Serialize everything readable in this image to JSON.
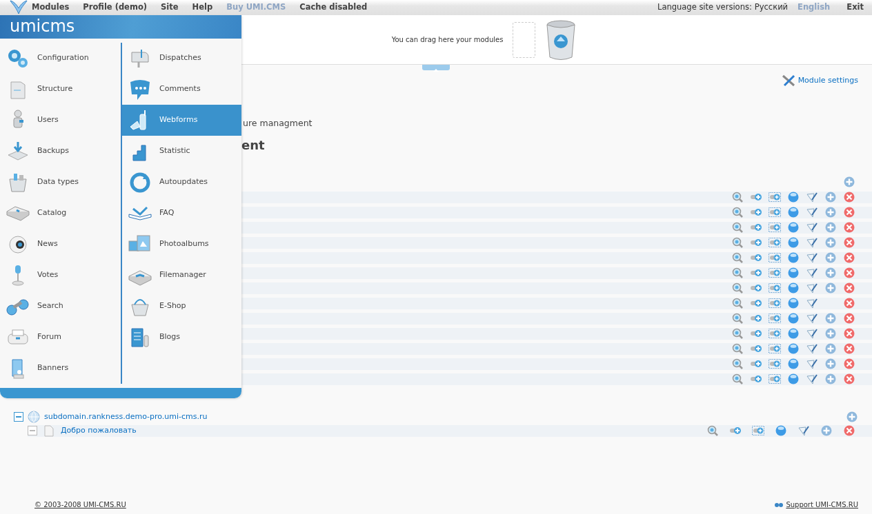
{
  "top_menu": [
    {
      "label": "Modules",
      "kind": "menu"
    },
    {
      "label": "Profile (demo)",
      "kind": "menu"
    },
    {
      "label": "Site",
      "kind": "menu"
    },
    {
      "label": "Help",
      "kind": "menu"
    },
    {
      "label": "Buy UMI.CMS",
      "kind": "promo"
    },
    {
      "label": "Cache disabled",
      "kind": "menu"
    }
  ],
  "languages": {
    "label": "Language site versions:",
    "items": [
      {
        "label": "Русский",
        "selected": true
      },
      {
        "label": "English",
        "selected": false
      }
    ]
  },
  "exit": "Exit",
  "dropzone": {
    "text": "You can drag here your modules"
  },
  "module_settings": "Module settings",
  "page": {
    "subtitle": "ure managment",
    "heading": "ent"
  },
  "rows": [
    {
      "can_add": true
    },
    {
      "can_add": true
    },
    {
      "can_add": true
    },
    {
      "can_add": true
    },
    {
      "can_add": true
    },
    {
      "can_add": true
    },
    {
      "can_add": true
    },
    {
      "can_add": false
    },
    {
      "can_add": true
    },
    {
      "can_add": true
    },
    {
      "can_add": true
    },
    {
      "can_add": true
    },
    {
      "can_add": true
    }
  ],
  "tree": {
    "domain": "subdomain.rankness.demo-pro.umi-cms.ru",
    "expanded": true,
    "children": [
      {
        "label": "Добро пожаловать",
        "expanded": true,
        "can_add": true
      }
    ]
  },
  "footer": {
    "copyright": "© 2003-2008 UMI-CMS.RU",
    "support": "Support UMI-CMS.RU"
  },
  "modules_menu": {
    "logo": "umicms",
    "columns": [
      [
        {
          "label": "Configuration",
          "selected": false
        },
        {
          "label": "Structure",
          "selected": false
        },
        {
          "label": "Users",
          "selected": false
        },
        {
          "label": "Backups",
          "selected": false
        },
        {
          "label": "Data types",
          "selected": false
        },
        {
          "label": "Catalog",
          "selected": false
        },
        {
          "label": "News",
          "selected": false
        },
        {
          "label": "Votes",
          "selected": false
        },
        {
          "label": "Search",
          "selected": false
        },
        {
          "label": "Forum",
          "selected": false
        },
        {
          "label": "Banners",
          "selected": false
        }
      ],
      [
        {
          "label": "Dispatches",
          "selected": false
        },
        {
          "label": "Comments",
          "selected": false
        },
        {
          "label": "Webforms",
          "selected": true
        },
        {
          "label": "Statistic",
          "selected": false
        },
        {
          "label": "Autoupdates",
          "selected": false
        },
        {
          "label": "FAQ",
          "selected": false
        },
        {
          "label": "Photoalbums",
          "selected": false
        },
        {
          "label": "Filemanager",
          "selected": false
        },
        {
          "label": "E-Shop",
          "selected": false
        },
        {
          "label": "Blogs",
          "selected": false
        }
      ]
    ]
  }
}
